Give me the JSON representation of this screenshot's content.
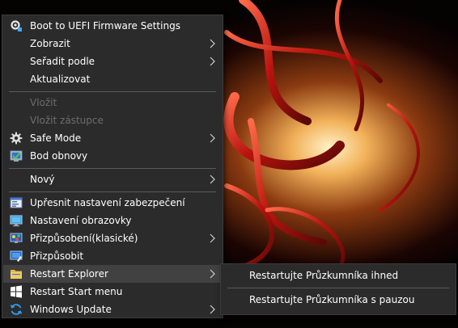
{
  "menu": {
    "items": [
      {
        "label": "Boot to UEFI Firmware Settings",
        "icon": "gear-settings-icon",
        "submenu": false,
        "disabled": false
      },
      {
        "label": "Zobrazit",
        "icon": "",
        "submenu": true,
        "disabled": false
      },
      {
        "label": "Seřadit podle",
        "icon": "",
        "submenu": true,
        "disabled": false
      },
      {
        "label": "Aktualizovat",
        "icon": "",
        "submenu": false,
        "disabled": false
      },
      {
        "label": "Vložit",
        "icon": "",
        "submenu": false,
        "disabled": true
      },
      {
        "label": "Vložit zástupce",
        "icon": "",
        "submenu": false,
        "disabled": true
      },
      {
        "label": "Safe Mode",
        "icon": "gear-icon",
        "submenu": true,
        "disabled": false
      },
      {
        "label": "Bod obnovy",
        "icon": "restore-point-icon",
        "submenu": false,
        "disabled": false
      },
      {
        "label": "Nový",
        "icon": "",
        "submenu": true,
        "disabled": false
      },
      {
        "label": "Upřesnit nastavení zabezpečení",
        "icon": "security-settings-icon",
        "submenu": false,
        "disabled": false
      },
      {
        "label": "Nastavení obrazovky",
        "icon": "display-icon",
        "submenu": false,
        "disabled": false
      },
      {
        "label": "Přizpůsobení(klasické)",
        "icon": "personalize-classic-icon",
        "submenu": true,
        "disabled": false
      },
      {
        "label": "Přizpůsobit",
        "icon": "personalize-icon",
        "submenu": false,
        "disabled": false
      },
      {
        "label": "Restart Explorer",
        "icon": "folder-icon",
        "submenu": true,
        "disabled": false,
        "active": true
      },
      {
        "label": "Restart Start menu",
        "icon": "windows-logo-icon",
        "submenu": false,
        "disabled": false
      },
      {
        "label": "Windows Update",
        "icon": "windows-update-icon",
        "submenu": true,
        "disabled": false
      }
    ]
  },
  "submenu": {
    "items": [
      {
        "label": "Restartujte Průzkumníka ihned"
      },
      {
        "label": "Restartujte Průzkumníka s pauzou"
      }
    ]
  },
  "colors": {
    "menu_bg": "#2b2b2b",
    "hover_bg": "#414141",
    "separator": "#5a5a5a",
    "disabled_text": "#6d6d6d",
    "text": "#ffffff"
  }
}
